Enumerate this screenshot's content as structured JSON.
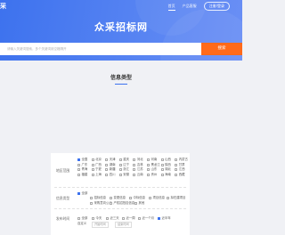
{
  "header": {
    "logo_text": "采",
    "nav": [
      "首页",
      "产品客服"
    ],
    "nav_button": "注册/登录",
    "site_title": "众采招标网"
  },
  "search": {
    "placeholder": "请输入关键词搜索，多个关键词用空格隔开",
    "button_label": "搜索"
  },
  "section": {
    "title": "信息类型"
  },
  "filters": {
    "region": {
      "label": "地区范围",
      "options": [
        {
          "text": "全国",
          "checked": true
        },
        {
          "text": "北京",
          "checked": false
        },
        {
          "text": "天津",
          "checked": false
        },
        {
          "text": "重庆",
          "checked": false
        },
        {
          "text": "河北",
          "checked": false
        },
        {
          "text": "河南",
          "checked": false
        },
        {
          "text": "山西",
          "checked": false
        },
        {
          "text": "内蒙古",
          "checked": false
        },
        {
          "text": "广东",
          "checked": false
        },
        {
          "text": "广西",
          "checked": false
        },
        {
          "text": "湖南",
          "checked": false
        },
        {
          "text": "辽宁",
          "checked": false
        },
        {
          "text": "吉林",
          "checked": false
        },
        {
          "text": "黑龙江",
          "checked": false
        },
        {
          "text": "陕西",
          "checked": false
        },
        {
          "text": "甘肃",
          "checked": false
        },
        {
          "text": "青海",
          "checked": false
        },
        {
          "text": "宁夏",
          "checked": false
        },
        {
          "text": "新疆",
          "checked": false
        },
        {
          "text": "浙江",
          "checked": false
        },
        {
          "text": "江苏",
          "checked": false
        },
        {
          "text": "山东",
          "checked": false
        },
        {
          "text": "湖北",
          "checked": false
        },
        {
          "text": "江西",
          "checked": false
        },
        {
          "text": "福建",
          "checked": false
        },
        {
          "text": "上海",
          "checked": false
        },
        {
          "text": "四川",
          "checked": false
        },
        {
          "text": "安徽",
          "checked": false
        },
        {
          "text": "云南",
          "checked": false
        },
        {
          "text": "贵州",
          "checked": false
        },
        {
          "text": "海南",
          "checked": false
        },
        {
          "text": "西藏",
          "checked": false
        }
      ]
    },
    "type": {
      "label": "信息类型",
      "options": [
        {
          "text": "全部",
          "checked": true
        },
        {
          "text": "招标信息",
          "checked": false
        },
        {
          "text": "变更信息",
          "checked": false
        },
        {
          "text": "中标信息",
          "checked": false
        },
        {
          "text": "项目信息",
          "checked": false
        },
        {
          "text": "拟在建项目",
          "checked": false
        },
        {
          "text": "采购意向公示",
          "checked": false
        },
        {
          "text": "产权招拍挂信息",
          "checked": false
        },
        {
          "text": "其他",
          "checked": false
        }
      ]
    },
    "time": {
      "label": "发布时间",
      "options": [
        {
          "text": "全部",
          "checked": false
        },
        {
          "text": "今天",
          "checked": false
        },
        {
          "text": "近三天",
          "checked": false
        },
        {
          "text": "近一周",
          "checked": false
        },
        {
          "text": "近一个月",
          "checked": false
        },
        {
          "text": "近半年",
          "checked": true
        }
      ],
      "custom_label": "自定义",
      "start_placeholder": "开始时间",
      "end_placeholder": "结束时间"
    }
  },
  "colors": {
    "primary": "#3d72ee",
    "accent": "#ff6a1a",
    "background": "#f0f1f5"
  }
}
